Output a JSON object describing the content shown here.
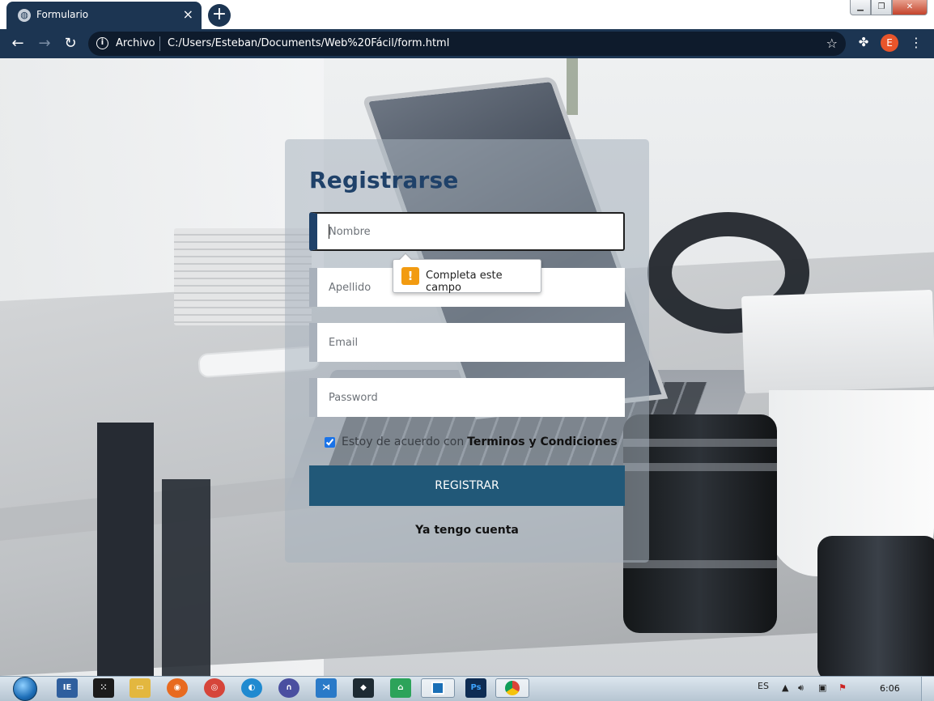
{
  "browser": {
    "tab_title": "Formulario",
    "tab_close": "×",
    "new_tab": "+",
    "omnibox": {
      "scheme_label": "Archivo",
      "url": "C:/Users/Esteban/Documents/Web%20Fácil/form.html"
    },
    "profile_initial": "E",
    "accent_color": "#1c3552"
  },
  "form": {
    "title": "Registrarse",
    "fields": {
      "nombre_placeholder": "Nombre",
      "apellido_placeholder": "Apellido",
      "email_placeholder": "Email",
      "password_placeholder": "Password"
    },
    "validation_tooltip": "Completa este campo",
    "agree_text": "Estoy de acuerdo con",
    "agree_link": "Terminos y Condiciones",
    "agree_checked": true,
    "submit_label": "REGISTRAR",
    "login_link": "Ya tengo cuenta",
    "title_color": "#1f4169",
    "button_color": "#215878"
  },
  "taskbar": {
    "language": "ES",
    "clock": "6:06",
    "apps": [
      "start-orb",
      "ie-icon",
      "blackberry-icon",
      "folder-icon",
      "firefox-icon",
      "chrome-icon",
      "edge-icon",
      "headphones-app-icon",
      "vscode-icon",
      "kindle-icon",
      "green-app-icon",
      "active-window-icon",
      "photoshop-icon",
      "chrome-active-icon"
    ]
  }
}
